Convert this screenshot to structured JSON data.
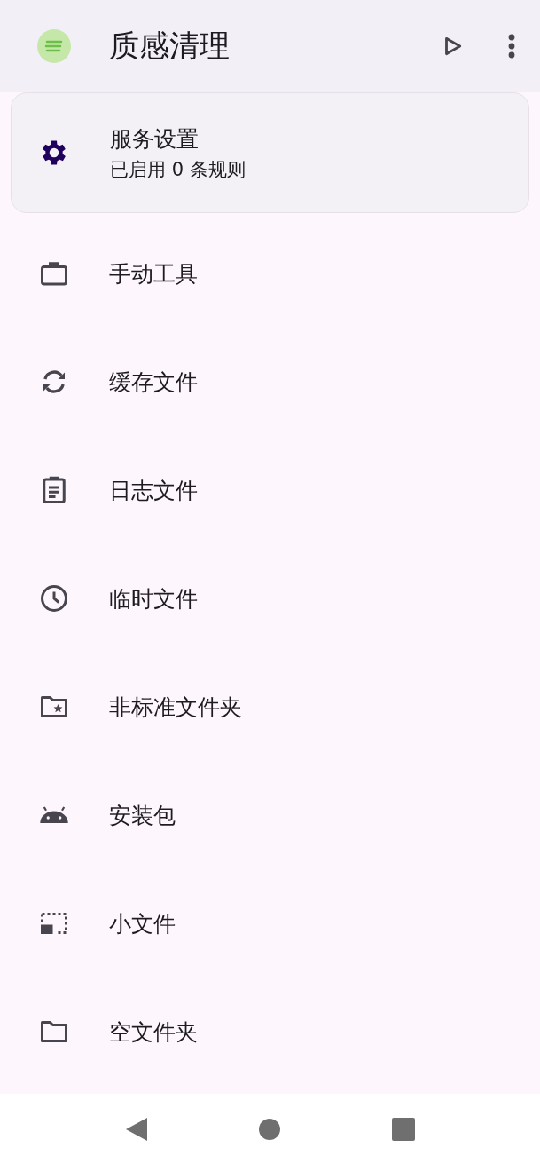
{
  "app_bar": {
    "title": "质感清理"
  },
  "service_card": {
    "title": "服务设置",
    "subtitle": "已启用 0 条规则"
  },
  "menu_items": [
    {
      "label": "手动工具",
      "kind": "briefcase"
    },
    {
      "label": "缓存文件",
      "kind": "sync"
    },
    {
      "label": "日志文件",
      "kind": "clipboard"
    },
    {
      "label": "临时文件",
      "kind": "clock"
    },
    {
      "label": "非标准文件夹",
      "kind": "folderstar"
    },
    {
      "label": "安装包",
      "kind": "android"
    },
    {
      "label": "小文件",
      "kind": "smallbox"
    },
    {
      "label": "空文件夹",
      "kind": "folder"
    }
  ]
}
